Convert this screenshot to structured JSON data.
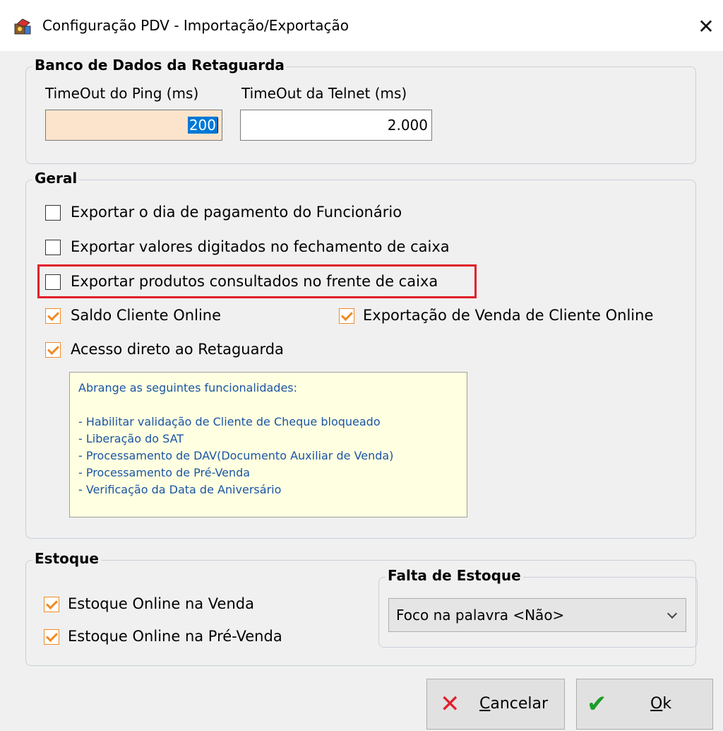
{
  "window": {
    "title": "Configuração PDV - Importação/Exportação",
    "close_glyph": "✕",
    "icon": "app-icon"
  },
  "banco": {
    "legend": "Banco de Dados da Retaguarda",
    "ping_label": "TimeOut do Ping (ms)",
    "ping_value": "200",
    "telnet_label": "TimeOut da Telnet (ms)",
    "telnet_value": "2.000"
  },
  "geral": {
    "legend": "Geral",
    "options": [
      {
        "label": "Exportar o dia de pagamento do Funcionário",
        "checked": false
      },
      {
        "label": "Exportar valores digitados no fechamento de caixa",
        "checked": false
      },
      {
        "label": "Exportar produtos consultados no frente de caixa",
        "checked": false,
        "highlighted": true
      },
      {
        "label": "Saldo Cliente Online",
        "checked": true
      },
      {
        "label": "Exportação de Venda de Cliente Online",
        "checked": true
      },
      {
        "label": "Acesso direto ao Retaguarda",
        "checked": true
      }
    ],
    "info": {
      "heading": "Abrange as seguintes funcionalidades:",
      "lines": [
        "- Habilitar validação de Cliente de Cheque bloqueado",
        "- Liberação do SAT",
        "- Processamento de DAV(Documento Auxiliar de Venda)",
        "- Processamento de Pré-Venda",
        "- Verificação da Data de Aniversário"
      ]
    }
  },
  "estoque": {
    "legend": "Estoque",
    "options": [
      {
        "label": "Estoque Online na Venda",
        "checked": true
      },
      {
        "label": "Estoque Online na Pré-Venda",
        "checked": true
      }
    ],
    "falta": {
      "legend": "Falta de Estoque",
      "selected": "Foco na palavra <Não>"
    }
  },
  "buttons": {
    "cancel": {
      "mnemonic": "C",
      "rest": "ancelar"
    },
    "ok": {
      "mnemonic": "O",
      "rest": "k"
    }
  },
  "colors": {
    "check_accent": "#f08a24",
    "highlight_border": "#e0202a",
    "selection": "#0078d7",
    "ping_field_bg": "#fce4cc",
    "info_text": "#1a55a6",
    "info_bg": "#ffffe1"
  }
}
